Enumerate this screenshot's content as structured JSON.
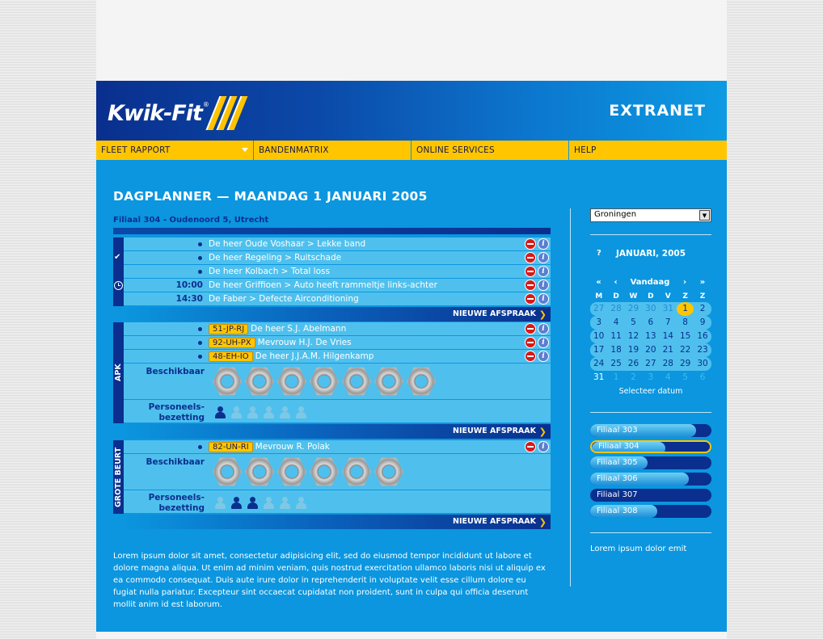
{
  "header": {
    "logo_text": "Kwik-Fit",
    "logo_reg": "®",
    "extranet": "EXTRANET"
  },
  "nav": [
    "FLEET RAPPORT",
    "BANDENMATRIX",
    "ONLINE SERVICES",
    "HELP"
  ],
  "page_title": "DAGPLANNER — MAANDAG 1 JANUARI 2005",
  "branch": "Filiaal 304 - Oudenoord 5, Utrecht",
  "general": {
    "rows": [
      {
        "time": "",
        "text": "De heer Oude Voshaar > Lekke band"
      },
      {
        "time": "",
        "text": "De heer Regeling > Ruitschade"
      },
      {
        "time": "",
        "text": "De heer Kolbach > Total loss"
      },
      {
        "time": "10:00",
        "text": "De heer Griffioen > Auto heeft rammeltje links-achter"
      },
      {
        "time": "14:30",
        "text": "De Faber > Defecte Airconditioning"
      }
    ],
    "new_label": "NIEUWE AFSPRAAK"
  },
  "apk": {
    "label": "APK",
    "rows": [
      {
        "plate": "51-JP-RJ",
        "text": "De heer S.J. Abelmann"
      },
      {
        "plate": "92-UH-PX",
        "text": "Mevrouw H.J. De Vries"
      },
      {
        "plate": "48-EH-IO",
        "text": "De heer J.J.A.M. Hilgenkamp"
      }
    ],
    "available_label": "Beschikbaar",
    "available_count": 7.5,
    "staff_label_1": "Personeels-",
    "staff_label_2": "bezetting",
    "staff": [
      true,
      false,
      false,
      false,
      false,
      false
    ],
    "new_label": "NIEUWE AFSPRAAK"
  },
  "grote": {
    "label": "GROTE BEURT",
    "rows": [
      {
        "plate": "82-UN-RI",
        "text": "Mevrouw R. Polak"
      }
    ],
    "available_label": "Beschikbaar",
    "available_count": 6,
    "staff_label_1": "Personeels-",
    "staff_label_2": "bezetting",
    "staff": [
      false,
      true,
      true,
      false,
      false,
      false
    ],
    "new_label": "NIEUWE AFSPRAAK"
  },
  "lorem": "Lorem ipsum dolor sit amet, consectetur adipisicing elit, sed do eiusmod tempor incididunt ut labore et dolore magna aliqua. Ut enim ad minim veniam, quis nostrud exercitation ullamco laboris nisi ut aliquip ex ea commodo consequat. Duis aute irure dolor in reprehenderit in voluptate velit esse cillum dolore eu fugiat nulla pariatur. Excepteur sint occaecat cupidatat non proident, sunt in culpa qui officia deserunt mollit anim id est laborum.",
  "sidebar": {
    "select_value": "Groningen",
    "calendar": {
      "help": "?",
      "title": "JANUARI, 2005",
      "nav": [
        "«",
        "‹",
        "Vandaag",
        "›",
        "»"
      ],
      "dow": [
        "M",
        "D",
        "W",
        "D",
        "V",
        "Z",
        "Z"
      ],
      "weeks": [
        [
          "27",
          "28",
          "29",
          "30",
          "31",
          "1",
          "2"
        ],
        [
          "3",
          "4",
          "5",
          "6",
          "7",
          "8",
          "9"
        ],
        [
          "10",
          "11",
          "12",
          "13",
          "14",
          "15",
          "16"
        ],
        [
          "17",
          "18",
          "19",
          "20",
          "21",
          "22",
          "23"
        ],
        [
          "24",
          "25",
          "26",
          "27",
          "28",
          "29",
          "30"
        ],
        [
          "31",
          "1",
          "2",
          "3",
          "4",
          "5",
          "6"
        ]
      ],
      "select_label": "Selecteer datum"
    },
    "branches": [
      {
        "label": "Filiaal 303",
        "fill": 0.87,
        "selected": false
      },
      {
        "label": "Filiaal 304",
        "fill": 0.62,
        "selected": true
      },
      {
        "label": "Filiaal 305",
        "fill": 0.47,
        "selected": false
      },
      {
        "label": "Filiaal 306",
        "fill": 0.81,
        "selected": false
      },
      {
        "label": "Filiaal 307",
        "fill": 0.0,
        "selected": false
      },
      {
        "label": "Filiaal 308",
        "fill": 0.55,
        "selected": false
      }
    ],
    "footer_text": "Lorem ipsum dolor emit"
  },
  "colors": {
    "brand_blue": "#0b96df",
    "dark_blue": "#0a2f8e",
    "yellow": "#ffc600",
    "row_blue": "#4fc0ed"
  }
}
